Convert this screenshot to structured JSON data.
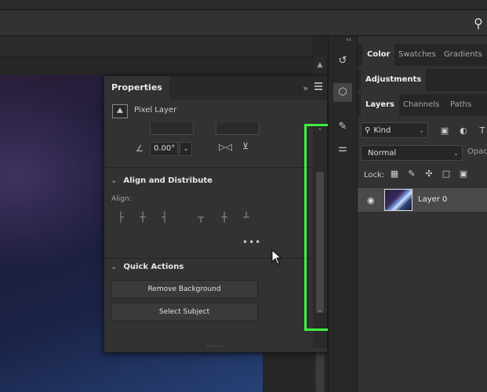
{
  "properties": {
    "tab_label": "Properties",
    "collapse_glyph": "»",
    "layer_type": "Pixel Layer",
    "angle_value": "0.00°",
    "align_section": {
      "title": "Align and Distribute",
      "align_label": "Align:",
      "more_glyph": "•••"
    },
    "quick_actions": {
      "title": "Quick Actions",
      "remove_bg": "Remove Background",
      "select_subject": "Select Subject"
    }
  },
  "right_panel": {
    "top_tabs": [
      "Color",
      "Swatches",
      "Gradients"
    ],
    "adjust_tab": "Adjustments",
    "layer_tabs": [
      "Layers",
      "Channels",
      "Paths"
    ],
    "kind_label": "Kind",
    "blend_mode": "Normal",
    "opacity_label": "Opac",
    "lock_label": "Lock:",
    "layer_name": "Layer 0"
  },
  "icons": {
    "search": "⚲",
    "collapse_panels": "‹‹",
    "history": "↺",
    "cube": "⬡",
    "brush": "🖌",
    "sliders": "⚌",
    "eye": "👁",
    "chevron_down": "⌄",
    "chevron_up": "⌃"
  },
  "colors": {
    "highlight": "#3ff03f",
    "panel": "#323232",
    "selected_row": "#4a4a4a"
  }
}
